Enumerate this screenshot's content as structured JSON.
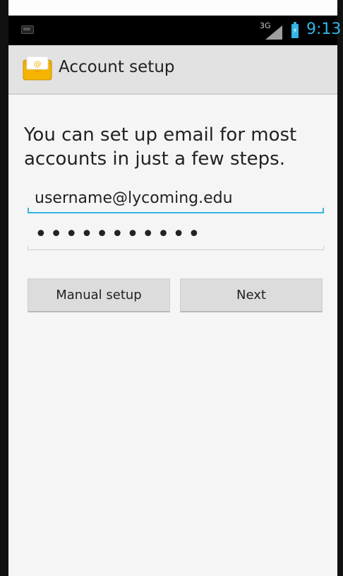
{
  "status_bar": {
    "network": "3G",
    "time": "9:13",
    "accent_color": "#33b5e5"
  },
  "action_bar": {
    "title": "Account setup",
    "icon": "email-app-icon"
  },
  "form": {
    "prompt": "You can set up email for most accounts in just a few steps.",
    "email_value": "username@lycoming.edu",
    "password_value": "•••••••••••"
  },
  "buttons": {
    "manual_label": "Manual setup",
    "next_label": "Next"
  }
}
